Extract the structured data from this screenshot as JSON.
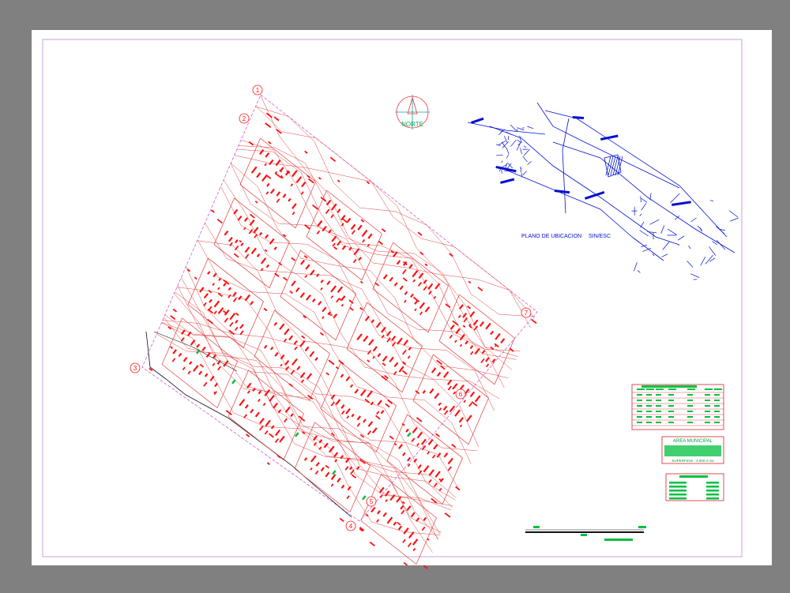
{
  "colors": {
    "viewport": "#808080",
    "paper": "#ffffff",
    "margin_frame": "#c8a0d8",
    "plot": "#ff1010",
    "contour": "#e04040",
    "boundary": "#111111",
    "location_map": "#0010d0",
    "tables": "#e02020",
    "green": "#00c040"
  },
  "north_arrow": {
    "label": "NORTE"
  },
  "vertices": [
    "1",
    "2",
    "3",
    "4",
    "5",
    "6",
    "7"
  ],
  "location_map": {
    "title": "PLANO DE UBICACION",
    "scale": "SIN/ESC"
  },
  "municipal_area": {
    "title": "AREA MUNICIPAL",
    "surface": "SUPERFICIE : 4,000.4 m2"
  },
  "scale_bar": {
    "label": "ESCALA"
  }
}
